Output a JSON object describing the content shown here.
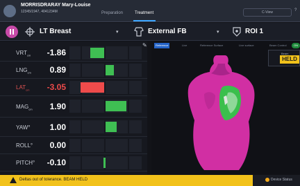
{
  "header": {
    "patient_name": "MORRISDRARAY Mary-Louise",
    "patient_id": "12345/1947, 4041234M",
    "tabs": [
      {
        "label": "Preparation",
        "active": false
      },
      {
        "label": "Treatment",
        "active": true
      }
    ],
    "status_text": "C-View",
    "edge_text": "?"
  },
  "selection": {
    "site": "LT Breast",
    "plan": "External FB",
    "roi": "ROI 1"
  },
  "offsets": [
    {
      "axis": "VRT",
      "unit": "cm",
      "value": "-1.86",
      "status": "ok"
    },
    {
      "axis": "LNG",
      "unit": "cm",
      "value": "0.89",
      "status": "ok"
    },
    {
      "axis": "LAT",
      "unit": "cm",
      "value": "-3.05",
      "status": "out_of_tolerance"
    },
    {
      "axis": "MAG",
      "unit": "cm",
      "value": "1.90",
      "status": "ok"
    },
    {
      "axis": "YAW",
      "unit": "°",
      "value": "1.00",
      "status": "ok"
    },
    {
      "axis": "ROLL",
      "unit": "°",
      "value": "0.00",
      "status": "ok"
    },
    {
      "axis": "PITCH",
      "unit": "°",
      "value": "-0.10",
      "status": "ok"
    }
  ],
  "view": {
    "tabs": [
      "Reference",
      "Live",
      "Reference Surface",
      "Live surface",
      "Beam Control"
    ],
    "active_tab": "Reference",
    "toggle_label": "ON",
    "beam_label": "Beam",
    "beam_status": "HELD"
  },
  "alert": {
    "message": "Deltas out of tolerance. BEAM HELD",
    "device_status": "Device Status"
  },
  "colors": {
    "ok": "#3fbf53",
    "alert": "#ee4b4b",
    "surface": "#d12fa3",
    "warning": "#f2c21b"
  }
}
